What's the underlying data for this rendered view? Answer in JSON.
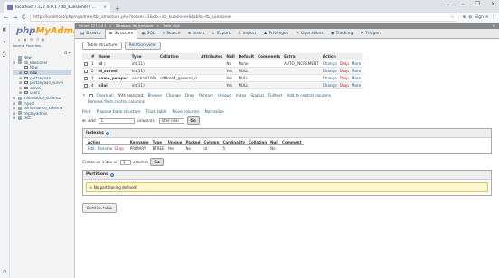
{
  "browser": {
    "tab_title": "localhost / 127.0.0.1 / db_kuesioner / ...",
    "tab_close": "×",
    "new_tab": "+",
    "win": [
      "⌄",
      "–",
      "❐",
      "✕"
    ],
    "url": "http://localhost/phpmyadmin/tbl_structure.php?server=1&db=db_kuesioner&table=tb_kuesioner",
    "account": "Sign in",
    "nav": [
      "←",
      "→",
      "C"
    ]
  },
  "rail": [
    "◧",
    "★",
    "⌚",
    "◷"
  ],
  "sidebar": {
    "logo_a": "php",
    "logo_b": "MyAdmin",
    "logo_icons": "⌂ ▣ ⚙ ↺ ◈",
    "tabs": [
      "Recent",
      "Favorites"
    ],
    "collapse": "⊟ ↔",
    "tree": [
      {
        "label": "New",
        "indent": 0,
        "toggle": "",
        "type": "db"
      },
      {
        "label": "db_kuesioner",
        "indent": 0,
        "toggle": "⊟",
        "type": "db"
      },
      {
        "label": "New",
        "indent": 1,
        "toggle": "",
        "type": "tb"
      },
      {
        "label": "nilai",
        "indent": 1,
        "toggle": "⊞",
        "type": "tb",
        "selected": true
      },
      {
        "label": "pertanyaan",
        "indent": 1,
        "toggle": "⊞",
        "type": "tb"
      },
      {
        "label": "pertanyaan_survei",
        "indent": 1,
        "toggle": "⊞",
        "type": "tb"
      },
      {
        "label": "survei",
        "indent": 1,
        "toggle": "⊞",
        "type": "tb"
      },
      {
        "label": "users",
        "indent": 1,
        "toggle": "⊞",
        "type": "tb"
      },
      {
        "label": "information_schema",
        "indent": 0,
        "toggle": "⊞",
        "type": "db"
      },
      {
        "label": "mysql",
        "indent": 0,
        "toggle": "⊞",
        "type": "db"
      },
      {
        "label": "performance_schema",
        "indent": 0,
        "toggle": "⊞",
        "type": "db"
      },
      {
        "label": "phpmyadmin",
        "indent": 0,
        "toggle": "⊞",
        "type": "db"
      },
      {
        "label": "test",
        "indent": 0,
        "toggle": "⊞",
        "type": "db"
      }
    ]
  },
  "breadcrumb": [
    "Server: 127.0.0.1",
    "Database: db_kuesioner",
    "Table: nilai"
  ],
  "breadcrumb_gear": "⚙",
  "menu": [
    {
      "label": "Browse",
      "icon": "▤"
    },
    {
      "label": "Structure",
      "icon": "⊞",
      "active": true
    },
    {
      "label": "SQL",
      "icon": "▦"
    },
    {
      "label": "Search",
      "icon": "⌕"
    },
    {
      "label": "Insert",
      "icon": "⊕"
    },
    {
      "label": "Export",
      "icon": "⇪"
    },
    {
      "label": "Import",
      "icon": "⇩"
    },
    {
      "label": "Privileges",
      "icon": "♟"
    },
    {
      "label": "Operations",
      "icon": "✎"
    },
    {
      "label": "Tracking",
      "icon": "◉"
    },
    {
      "label": "Triggers",
      "icon": "⚑"
    }
  ],
  "subtabs": [
    "Table structure",
    "Relation view"
  ],
  "columns": {
    "headers": [
      "",
      "#",
      "Name",
      "Type",
      "Collation",
      "Attributes",
      "Null",
      "Default",
      "Comments",
      "Extra",
      "Action"
    ],
    "rows": [
      {
        "num": "1",
        "name": "id",
        "key": true,
        "type": "int(11)",
        "collation": "",
        "attributes": "",
        "null": "No",
        "default": "None",
        "comments": "",
        "extra": "AUTO_INCREMENT"
      },
      {
        "num": "2",
        "name": "id_survei",
        "key": false,
        "type": "int(11)",
        "collation": "",
        "attributes": "",
        "null": "Yes",
        "default": "NULL",
        "comments": "",
        "extra": ""
      },
      {
        "num": "3",
        "name": "nama_pelapor",
        "key": false,
        "type": "varchar(100)",
        "collation": "utf8mb4_general_ci",
        "attributes": "",
        "null": "Yes",
        "default": "NULL",
        "comments": "",
        "extra": ""
      },
      {
        "num": "4",
        "name": "nilai",
        "key": false,
        "type": "int(11)",
        "collation": "",
        "attributes": "",
        "null": "Yes",
        "default": "NULL",
        "comments": "",
        "extra": ""
      }
    ],
    "actions": [
      "Change",
      "Drop",
      "More"
    ]
  },
  "bulk": {
    "check_all": "Check all",
    "with_selected": "With selected:",
    "items": [
      "Browse",
      "Change",
      "Drop",
      "Primary",
      "Unique",
      "Index",
      "Spatial",
      "Fulltext",
      "Add to central columns"
    ],
    "remove": "Remove from central columns"
  },
  "tools": [
    "Print",
    "Propose table structure",
    "Track table",
    "Move columns",
    "Normalize"
  ],
  "addrow": {
    "label": "Add",
    "value": "1",
    "cols_label": "column(s)",
    "position": "after nilai",
    "go": "Go"
  },
  "indexes": {
    "title": "Indexes",
    "headers": [
      "Action",
      "",
      "Keyname",
      "Type",
      "Unique",
      "Packed",
      "Column",
      "Cardinality",
      "Collation",
      "Null",
      "Comment"
    ],
    "row": [
      "Edit",
      "Rename",
      "Drop",
      "PRIMARY",
      "BTREE",
      "Yes",
      "No",
      "id",
      "5",
      "A",
      "No",
      ""
    ]
  },
  "create_index": {
    "label": "Create an index on",
    "value": "1",
    "suffix": "columns",
    "go": "Go"
  },
  "partitions": {
    "title": "Partitions",
    "notice": "No partitioning defined!"
  },
  "partition_button": "Partition table"
}
